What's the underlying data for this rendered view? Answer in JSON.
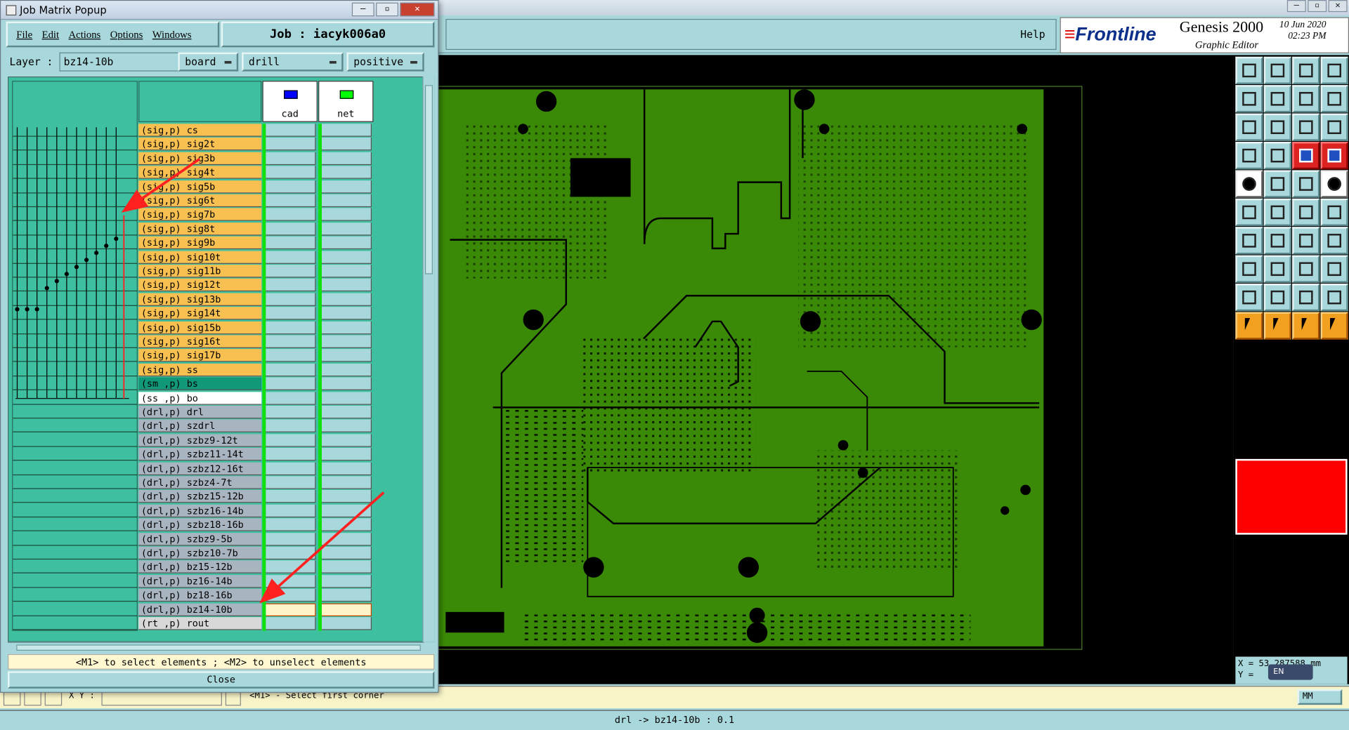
{
  "popup": {
    "title": "Job Matrix Popup",
    "menu": [
      "File",
      "Edit",
      "Actions",
      "Options",
      "Windows"
    ],
    "job_label": "Job : iacyk006a0",
    "layer_label": "Layer :",
    "layer_value": "bz14-10b",
    "context": "board",
    "type": "drill",
    "polarity": "positive",
    "columns": [
      {
        "name": "cad",
        "color": "#0000ff"
      },
      {
        "name": "net",
        "color": "#00ff00"
      }
    ],
    "layers": [
      {
        "label": "(sig,p) cs",
        "kind": "sig"
      },
      {
        "label": "(sig,p) sig2t",
        "kind": "sig"
      },
      {
        "label": "(sig,p) sig3b",
        "kind": "sig"
      },
      {
        "label": "(sig,p) sig4t",
        "kind": "sig"
      },
      {
        "label": "(sig,p) sig5b",
        "kind": "sig"
      },
      {
        "label": "(sig,p) sig6t",
        "kind": "sig"
      },
      {
        "label": "(sig,p) sig7b",
        "kind": "sig"
      },
      {
        "label": "(sig,p) sig8t",
        "kind": "sig"
      },
      {
        "label": "(sig,p) sig9b",
        "kind": "sig"
      },
      {
        "label": "(sig,p) sig10t",
        "kind": "sig"
      },
      {
        "label": "(sig,p) sig11b",
        "kind": "sig"
      },
      {
        "label": "(sig,p) sig12t",
        "kind": "sig"
      },
      {
        "label": "(sig,p) sig13b",
        "kind": "sig"
      },
      {
        "label": "(sig,p) sig14t",
        "kind": "sig"
      },
      {
        "label": "(sig,p) sig15b",
        "kind": "sig"
      },
      {
        "label": "(sig,p) sig16t",
        "kind": "sig"
      },
      {
        "label": "(sig,p) sig17b",
        "kind": "sig"
      },
      {
        "label": "(sig,p) ss",
        "kind": "sig"
      },
      {
        "label": "(sm ,p) bs",
        "kind": "sm"
      },
      {
        "label": "(ss ,p) bo",
        "kind": "ss"
      },
      {
        "label": "(drl,p) drl",
        "kind": "drl"
      },
      {
        "label": "(drl,p) szdrl",
        "kind": "drl"
      },
      {
        "label": "(drl,p) szbz9-12t",
        "kind": "drl"
      },
      {
        "label": "(drl,p) szbz11-14t",
        "kind": "drl"
      },
      {
        "label": "(drl,p) szbz12-16t",
        "kind": "drl"
      },
      {
        "label": "(drl,p) szbz4-7t",
        "kind": "drl"
      },
      {
        "label": "(drl,p) szbz15-12b",
        "kind": "drl"
      },
      {
        "label": "(drl,p) szbz16-14b",
        "kind": "drl"
      },
      {
        "label": "(drl,p) szbz18-16b",
        "kind": "drl"
      },
      {
        "label": "(drl,p) szbz9-5b",
        "kind": "drl"
      },
      {
        "label": "(drl,p) szbz10-7b",
        "kind": "drl"
      },
      {
        "label": "(drl,p) bz15-12b",
        "kind": "drl"
      },
      {
        "label": "(drl,p) bz16-14b",
        "kind": "drl"
      },
      {
        "label": "(drl,p) bz18-16b",
        "kind": "drl"
      },
      {
        "label": "(drl,p) bz14-10b",
        "kind": "sel"
      },
      {
        "label": "(rt ,p) rout",
        "kind": "rt"
      }
    ],
    "hint": "<M1> to select elements ; <M2> to unselect elements",
    "close_label": "Close"
  },
  "editor": {
    "help_label": "Help",
    "brand": "Frontline",
    "product": "Genesis 2000",
    "subtitle": "Graphic Editor",
    "date": "10 Jun 2020",
    "time": "02:23 PM",
    "coord_x_label": "X =",
    "coord_x_value": "53.287588",
    "coord_y_label": "Y =",
    "coord_unit": "mm",
    "lang_badge": "EN",
    "units_label": "MM",
    "prompt_label": "X Y :",
    "prompt_text": "<M1> - Select first corner",
    "status_text": "drl -> bz14-10b : 0.1"
  },
  "colors": {
    "board_green": "#3a8a08",
    "panel_cyan": "#a9d8dc",
    "signal_layer": "#f8c050",
    "highlight_red": "#ff0000"
  }
}
